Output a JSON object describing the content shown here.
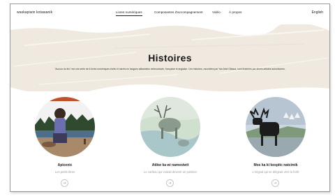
{
  "nav": {
    "brand": "waskapiwin kotawanik",
    "links": [
      "Livres numériques",
      "Composantes d'accompagnement",
      "Vidéo",
      "À propos"
    ],
    "language": "English"
  },
  "hero": {
    "title": "Histoires",
    "description": "\"Accour du feu\" est une série de 6 livres numériques écrits et narrés en langues atikamekw nehirowiswin, française et anglaise. Ces histoires, racontées par Yan Abel Ottawa, sont illustrées par divers artistes autochtones."
  },
  "cards": [
    {
      "title": "Apicenic",
      "subtitle": "Les petits êtres",
      "icon": "arrow-right-icon"
    },
    {
      "title": "Atikw ka wi namesiwit",
      "subtitle": "Le caribou qui voulait devenir un poisson",
      "icon": "arrow-right-icon"
    },
    {
      "title": "Mos ka ki kospitc natcimik",
      "subtitle": "L'orignal qui se dirigeait vers la forêt",
      "icon": "arrow-right-icon"
    }
  ],
  "colors": {
    "hero_band": "#efe9df",
    "text": "#1a1a1a",
    "muted": "#9a9a9a"
  }
}
